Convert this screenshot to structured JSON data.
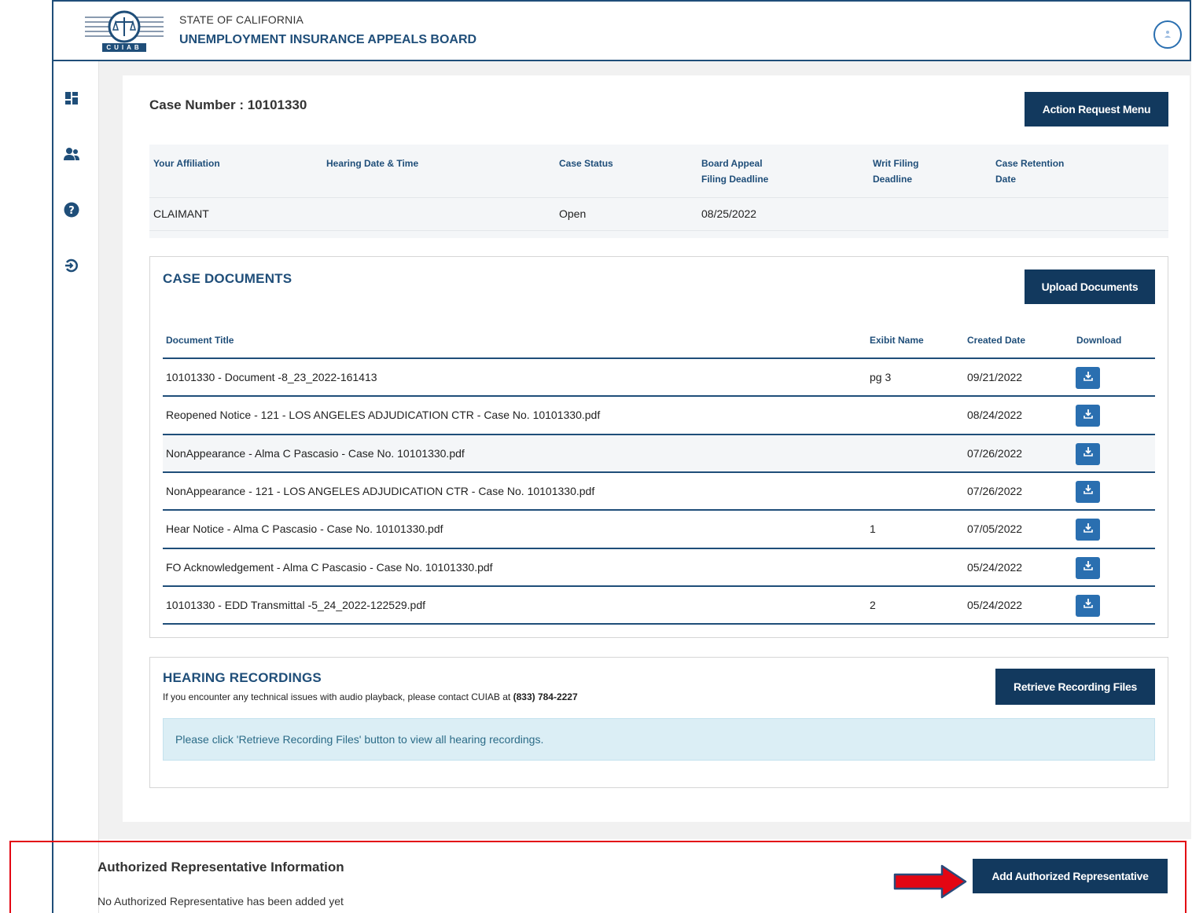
{
  "header": {
    "state_title": "STATE OF CALIFORNIA",
    "board_title": "UNEMPLOYMENT INSURANCE APPEALS BOARD",
    "logo_text": "CUIAB"
  },
  "sidebar": {
    "items": [
      {
        "icon": "dashboard-icon"
      },
      {
        "icon": "users-icon"
      },
      {
        "icon": "help-icon"
      },
      {
        "icon": "logout-icon"
      }
    ]
  },
  "case": {
    "number_label": "Case Number : 10101330",
    "action_button": "Action Request Menu",
    "columns": [
      {
        "line1": "Your Affiliation",
        "line2": ""
      },
      {
        "line1": "Hearing Date & Time",
        "line2": ""
      },
      {
        "line1": "Case Status",
        "line2": ""
      },
      {
        "line1": "Board Appeal",
        "line2": "Filing Deadline"
      },
      {
        "line1": "Writ Filing",
        "line2": "Deadline"
      },
      {
        "line1": "Case Retention",
        "line2": "Date"
      }
    ],
    "values": {
      "affiliation": "CLAIMANT",
      "hearing": "",
      "status": "Open",
      "board_deadline": "08/25/2022",
      "writ_deadline": "",
      "retention": ""
    }
  },
  "documents": {
    "title": "CASE DOCUMENTS",
    "upload_button": "Upload Documents",
    "headers": {
      "title": "Document Title",
      "exhibit": "Exibit Name",
      "created": "Created Date",
      "download": "Download"
    },
    "rows": [
      {
        "title": "10101330 - Document -8_23_2022-161413",
        "exhibit": "pg 3",
        "date": "09/21/2022"
      },
      {
        "title": "Reopened Notice - 121 - LOS ANGELES ADJUDICATION CTR - Case No. 10101330.pdf",
        "exhibit": "",
        "date": "08/24/2022"
      },
      {
        "title": "NonAppearance - Alma C Pascasio - Case No. 10101330.pdf",
        "exhibit": "",
        "date": "07/26/2022"
      },
      {
        "title": "NonAppearance - 121 - LOS ANGELES ADJUDICATION CTR - Case No. 10101330.pdf",
        "exhibit": "",
        "date": "07/26/2022"
      },
      {
        "title": "Hear Notice - Alma C Pascasio - Case No. 10101330.pdf",
        "exhibit": "1",
        "date": "07/05/2022"
      },
      {
        "title": "FO Acknowledgement - Alma C Pascasio - Case No. 10101330.pdf",
        "exhibit": "",
        "date": "05/24/2022"
      },
      {
        "title": "10101330 - EDD Transmittal -5_24_2022-122529.pdf",
        "exhibit": "2",
        "date": "05/24/2022"
      }
    ]
  },
  "recordings": {
    "title": "HEARING RECORDINGS",
    "note": "If you encounter any technical issues with audio playback, please contact CUIAB at",
    "phone": "(833) 784-2227",
    "retrieve_button": "Retrieve Recording Files",
    "alert": "Please click 'Retrieve Recording Files' button to view all hearing recordings."
  },
  "representative": {
    "title": "Authorized Representative Information",
    "empty_text": "No Authorized Representative has been added yet",
    "add_button": "Add Authorized Representative"
  },
  "colors": {
    "navy": "#12395e",
    "accent": "#1f4e79",
    "download": "#2a6fb0",
    "highlight": "#e30613"
  }
}
